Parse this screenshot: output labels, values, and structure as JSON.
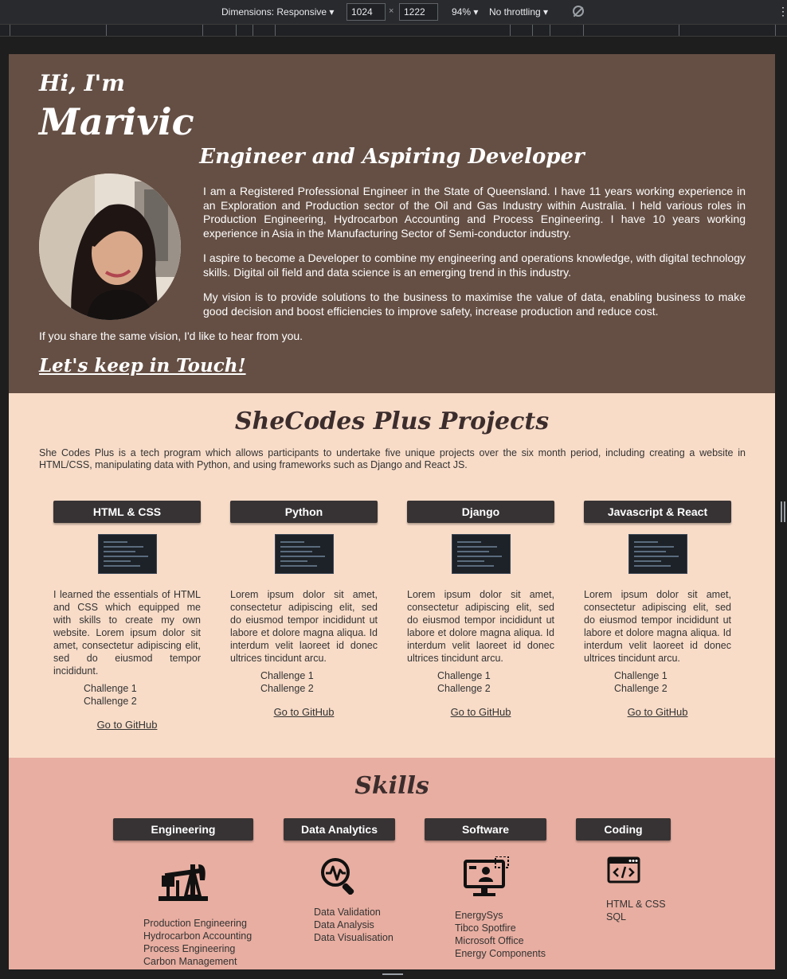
{
  "devtools": {
    "dimensions_label": "Dimensions: Responsive",
    "width": "1024",
    "height": "1222",
    "zoom": "94%",
    "throttling": "No throttling"
  },
  "hero": {
    "greeting": "Hi, I'm",
    "name": "Marivic",
    "role": "Engineer and Aspiring Developer",
    "bio": [
      "I am a Registered Professional Engineer in the State of Queensland. I have 11 years working experience in an Exploration and Production sector of the Oil and Gas Industry within Australia. I held various roles in Production Engineering, Hydrocarbon Accounting and Process Engineering. I have 10 years working experience in Asia in the Manufacturing Sector of Semi-conductor industry.",
      "I aspire to become a Developer to combine my engineering and operations knowledge, with digital technology skills. Digital oil field and data science is an emerging trend in this industry.",
      "My vision is to provide solutions to the business to maximise the value of data, enabling business to make good decision and boost efficiencies to improve safety, increase production and reduce cost."
    ],
    "share": "If you share the same vision, I'd like to hear from you.",
    "contact_link": "Let's keep in Touch!"
  },
  "projects": {
    "title": "SheCodes Plus Projects",
    "intro": "She Codes Plus is a tech program which allows participants to undertake five unique projects over the six month period, including creating a website in HTML/CSS, manipulating data with Python, and using frameworks such as Django and React JS.",
    "cards": [
      {
        "tag": "HTML & CSS",
        "desc": "I learned the essentials of HTML and CSS which equipped me with skills to create my own website. Lorem ipsum dolor sit amet, consectetur adipiscing elit, sed do eiusmod tempor incididunt.",
        "challenge1": "Challenge 1",
        "challenge2": "Challenge 2",
        "link": "Go to GitHub"
      },
      {
        "tag": "Python",
        "desc": "Lorem ipsum dolor sit amet, consectetur adipiscing elit, sed do eiusmod tempor incididunt ut labore et dolore magna aliqua. Id interdum velit laoreet id donec ultrices tincidunt arcu.",
        "challenge1": "Challenge 1",
        "challenge2": "Challenge 2",
        "link": "Go to GitHub"
      },
      {
        "tag": "Django",
        "desc": "Lorem ipsum dolor sit amet, consectetur adipiscing elit, sed do eiusmod tempor incididunt ut labore et dolore magna aliqua. Id interdum velit laoreet id donec ultrices tincidunt arcu.",
        "challenge1": "Challenge 1",
        "challenge2": "Challenge 2",
        "link": "Go to GitHub"
      },
      {
        "tag": "Javascript & React",
        "desc": "Lorem ipsum dolor sit amet, consectetur adipiscing elit, sed do eiusmod tempor incididunt ut labore et dolore magna aliqua. Id interdum velit laoreet id donec ultrices tincidunt arcu.",
        "challenge1": "Challenge 1",
        "challenge2": "Challenge 2",
        "link": "Go to GitHub"
      }
    ]
  },
  "skills": {
    "title": "Skills",
    "groups": [
      {
        "tag": "Engineering",
        "icon": "oil-pump-icon",
        "items": [
          "Production Engineering",
          "Hydrocarbon Accounting",
          "Process Engineering",
          "Carbon Management"
        ]
      },
      {
        "tag": "Data Analytics",
        "icon": "data-search-icon",
        "items": [
          "Data Validation",
          "Data Analysis",
          "Data Visualisation"
        ]
      },
      {
        "tag": "Software",
        "icon": "computer-user-icon",
        "items": [
          "EnergySys",
          "Tibco Spotfire",
          "Microsoft Office",
          "Energy Components"
        ]
      },
      {
        "tag": "Coding",
        "icon": "code-window-icon",
        "items": [
          "HTML & CSS",
          "SQL"
        ]
      }
    ]
  },
  "colors": {
    "hero_bg": "#654f44",
    "projects_bg": "#f8dcc8",
    "skills_bg": "#e8aea1",
    "tag_bg": "#373334"
  }
}
